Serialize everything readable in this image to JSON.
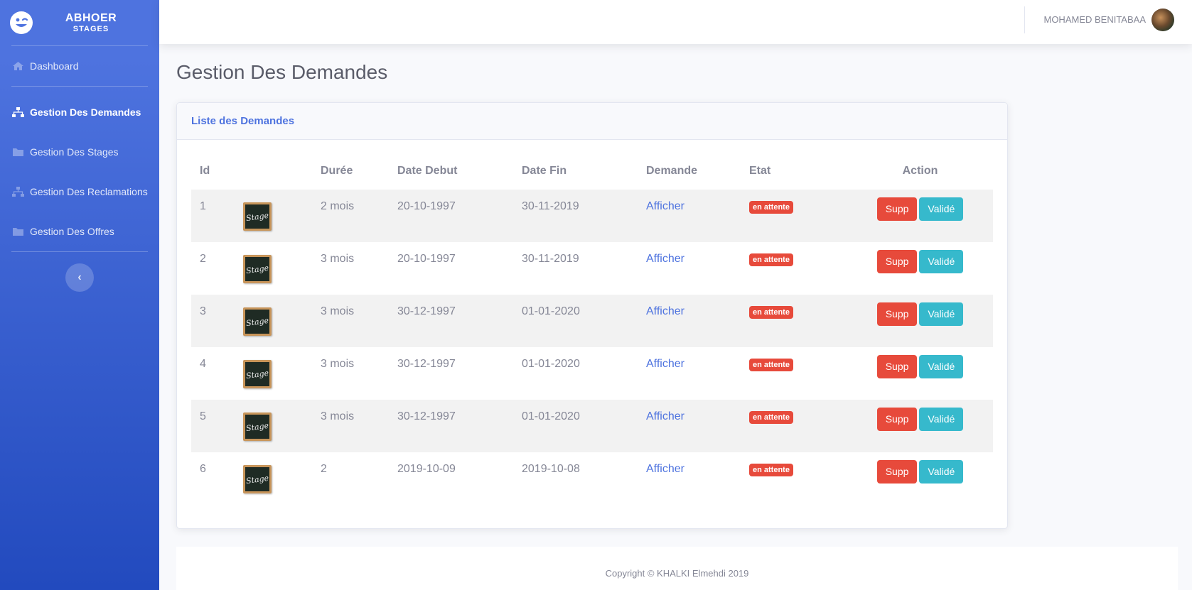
{
  "brand": {
    "title": "ABHOER",
    "subtitle": "STAGES",
    "icon": "laugh-wink-icon"
  },
  "sidebar": {
    "items": [
      {
        "label": "Dashboard",
        "icon": "home-icon",
        "active": false
      },
      {
        "label": "Gestion Des Demandes",
        "icon": "sitemap-icon",
        "active": true
      },
      {
        "label": "Gestion Des Stages",
        "icon": "folder-icon",
        "active": false
      },
      {
        "label": "Gestion Des Reclamations",
        "icon": "sitemap-icon",
        "active": false
      },
      {
        "label": "Gestion Des Offres",
        "icon": "folder-icon",
        "active": false
      }
    ],
    "toggle_icon": "chevron-left-icon"
  },
  "topbar": {
    "user_name": "MOHAMED BENITABAA"
  },
  "page": {
    "title": "Gestion Des Demandes"
  },
  "card": {
    "title": "Liste des Demandes"
  },
  "table": {
    "headers": [
      "Id",
      "",
      "Durée",
      "Date Debut",
      "Date Fin",
      "Demande",
      "Etat",
      "Action"
    ],
    "image_text": "Stage",
    "rows": [
      {
        "id": "1",
        "duree": "2 mois",
        "debut": "20-10-1997",
        "fin": "30-11-2019",
        "demande": "Afficher",
        "etat": "en attente",
        "supp": "Supp",
        "valide": "Validé"
      },
      {
        "id": "2",
        "duree": "3 mois",
        "debut": "20-10-1997",
        "fin": "30-11-2019",
        "demande": "Afficher",
        "etat": "en attente",
        "supp": "Supp",
        "valide": "Validé"
      },
      {
        "id": "3",
        "duree": "3 mois",
        "debut": "30-12-1997",
        "fin": "01-01-2020",
        "demande": "Afficher",
        "etat": "en attente",
        "supp": "Supp",
        "valide": "Validé"
      },
      {
        "id": "4",
        "duree": "3 mois",
        "debut": "30-12-1997",
        "fin": "01-01-2020",
        "demande": "Afficher",
        "etat": "en attente",
        "supp": "Supp",
        "valide": "Validé"
      },
      {
        "id": "5",
        "duree": "3 mois",
        "debut": "30-12-1997",
        "fin": "01-01-2020",
        "demande": "Afficher",
        "etat": "en attente",
        "supp": "Supp",
        "valide": "Validé"
      },
      {
        "id": "6",
        "duree": "2",
        "debut": "2019-10-09",
        "fin": "2019-10-08",
        "demande": "Afficher",
        "etat": "en attente",
        "supp": "Supp",
        "valide": "Validé"
      }
    ]
  },
  "footer": {
    "text": "Copyright © KHALKI Elmehdi 2019"
  },
  "colors": {
    "primary": "#4e73df",
    "danger": "#e74a3b",
    "info": "#36b9cc"
  }
}
